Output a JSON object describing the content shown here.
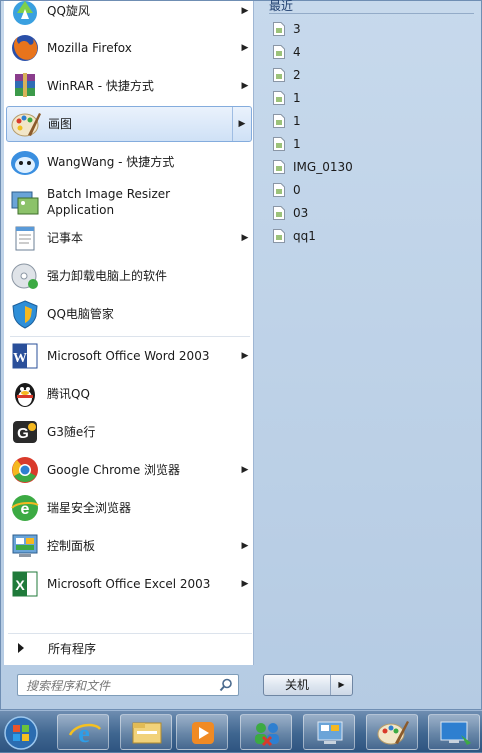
{
  "left_items": [
    {
      "label": "QQ旋风",
      "arrow": true
    },
    {
      "label": "Mozilla Firefox",
      "arrow": true
    },
    {
      "label": "WinRAR - 快捷方式",
      "arrow": true
    },
    {
      "label": "画图",
      "arrow": true,
      "selected": true
    },
    {
      "label": "WangWang - 快捷方式",
      "arrow": false
    },
    {
      "label": "Batch Image Resizer",
      "label2": "Application",
      "arrow": false
    },
    {
      "label": "记事本",
      "arrow": true
    },
    {
      "label": "强力卸载电脑上的软件",
      "arrow": false
    },
    {
      "label": "QQ电脑管家",
      "arrow": false
    },
    {
      "label": "Microsoft Office Word 2003",
      "arrow": true
    },
    {
      "label": "腾讯QQ",
      "arrow": false
    },
    {
      "label": "G3随e行",
      "arrow": false
    },
    {
      "label": "Google Chrome 浏览器",
      "arrow": true
    },
    {
      "label": "瑞星安全浏览器",
      "arrow": false
    },
    {
      "label": "控制面板",
      "arrow": true
    },
    {
      "label": "Microsoft Office Excel 2003",
      "arrow": true
    }
  ],
  "all_programs": "所有程序",
  "search": {
    "placeholder": "搜索程序和文件"
  },
  "recent": {
    "title": "最近",
    "items": [
      "3",
      "4",
      "2",
      "1",
      "1",
      "1",
      "IMG_0130",
      "0",
      "03",
      "qq1"
    ]
  },
  "shutdown": {
    "label": "关机"
  },
  "colors": {
    "accent": "#84acdd",
    "menu_bg": "#c7d9ec",
    "taskbar": "#3f6690"
  }
}
